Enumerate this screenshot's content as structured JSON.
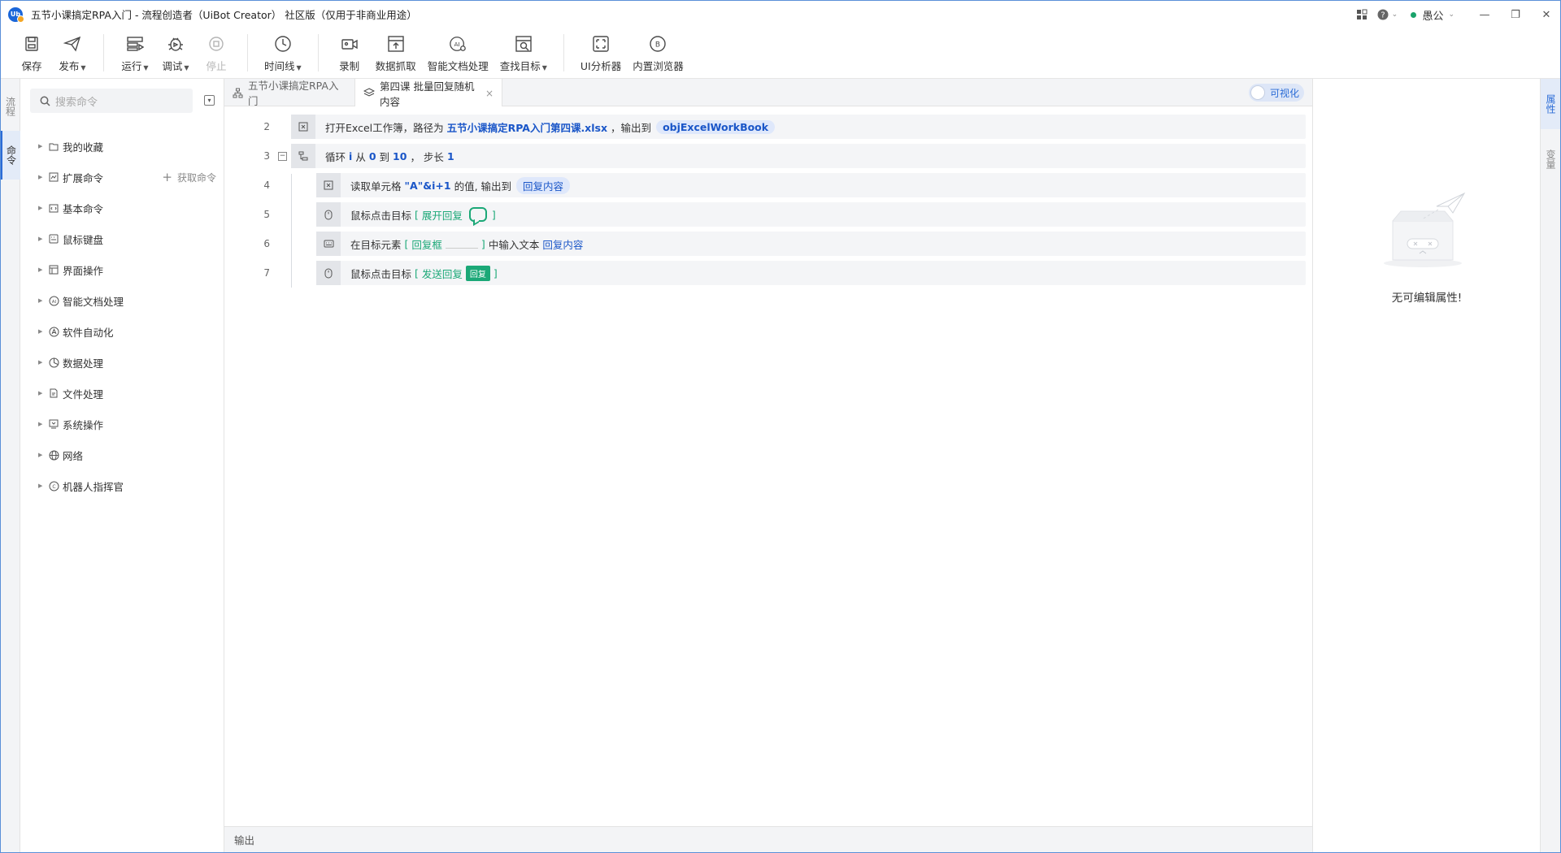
{
  "window": {
    "title": "五节小课搞定RPA入门 - 流程创造者（UiBot Creator） 社区版（仅用于非商业用途）",
    "logo_text": "Ub",
    "user": "愚公"
  },
  "toolbar": {
    "save": "保存",
    "publish": "发布",
    "run": "运行",
    "debug": "调试",
    "stop": "停止",
    "timeline": "时间线",
    "record": "录制",
    "data_scrape": "数据抓取",
    "smart_doc": "智能文档处理",
    "find_target": "查找目标",
    "ui_analyzer": "UI分析器",
    "builtin_browser": "内置浏览器"
  },
  "left_tabs": {
    "flow": "流程",
    "command": "命令"
  },
  "command_panel": {
    "search_placeholder": "搜索命令",
    "get_more": "获取命令",
    "items": [
      {
        "label": "我的收藏",
        "icon": "folder-icon"
      },
      {
        "label": "扩展命令",
        "icon": "extension-icon"
      },
      {
        "label": "基本命令",
        "icon": "code-icon"
      },
      {
        "label": "鼠标键盘",
        "icon": "keyboard-icon"
      },
      {
        "label": "界面操作",
        "icon": "window-icon"
      },
      {
        "label": "智能文档处理",
        "icon": "ai-icon"
      },
      {
        "label": "软件自动化",
        "icon": "app-icon"
      },
      {
        "label": "数据处理",
        "icon": "pie-icon"
      },
      {
        "label": "文件处理",
        "icon": "file-icon"
      },
      {
        "label": "系统操作",
        "icon": "system-icon"
      },
      {
        "label": "网络",
        "icon": "globe-icon"
      },
      {
        "label": "机器人指挥官",
        "icon": "commander-icon"
      }
    ]
  },
  "editor_tabs": {
    "tab1": "五节小课搞定RPA入门",
    "tab2": "第四课 批量回复随机内容",
    "visualize": "可视化"
  },
  "code": {
    "l2": {
      "no": "2",
      "t1": "打开Excel工作簿，路径为",
      "path": "五节小课搞定RPA入门第四课.xlsx",
      "t2": "，输出到",
      "var": "objExcelWorkBook"
    },
    "l3": {
      "no": "3",
      "t1": "循环",
      "i": "i",
      "t2": "从",
      "from": "0",
      "t3": "到",
      "to": "10",
      "t4": "，  步长",
      "step": "1"
    },
    "l4": {
      "no": "4",
      "t1": "读取单元格",
      "cell": "\"A\"&i+1",
      "t2": "的值, 输出到",
      "var": "回复内容"
    },
    "l5": {
      "no": "5",
      "t1": "鼠标点击目标",
      "lb": "[",
      "target": "展开回复",
      "rb": "]"
    },
    "l6": {
      "no": "6",
      "t1": "在目标元素",
      "lb": "[",
      "target": "回复框",
      "rb": "]",
      "t2": "中输入文本",
      "var": "回复内容"
    },
    "l7": {
      "no": "7",
      "t1": "鼠标点击目标",
      "lb": "[",
      "target": "发送回复",
      "btn": "回复",
      "rb": "]"
    }
  },
  "output": {
    "label": "输出"
  },
  "properties": {
    "empty_text": "无可编辑属性!"
  },
  "right_tabs": {
    "props": "属性",
    "vars": "变量"
  }
}
